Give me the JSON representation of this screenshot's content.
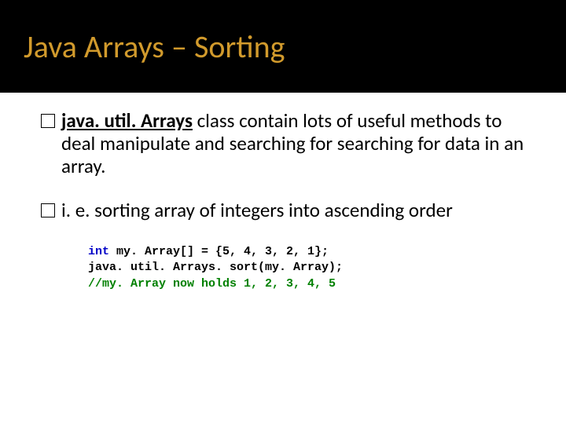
{
  "slide": {
    "title": "Java Arrays – Sorting"
  },
  "content": {
    "p1_strong": "java. util. Arrays",
    "p1_text": "  class contain lots  of useful methods to deal manipulate and searching for searching for data in an array.",
    "p2_text": "i. e.  sorting array of integers into ascending order"
  },
  "code": {
    "l1_kw": "int",
    "l1_rest": " my. Array[] = {5, 4, 3, 2, 1};",
    "l2": "java. util. Arrays. sort(my. Array);",
    "l3": "//my. Array now holds 1, 2, 3, 4, 5"
  }
}
